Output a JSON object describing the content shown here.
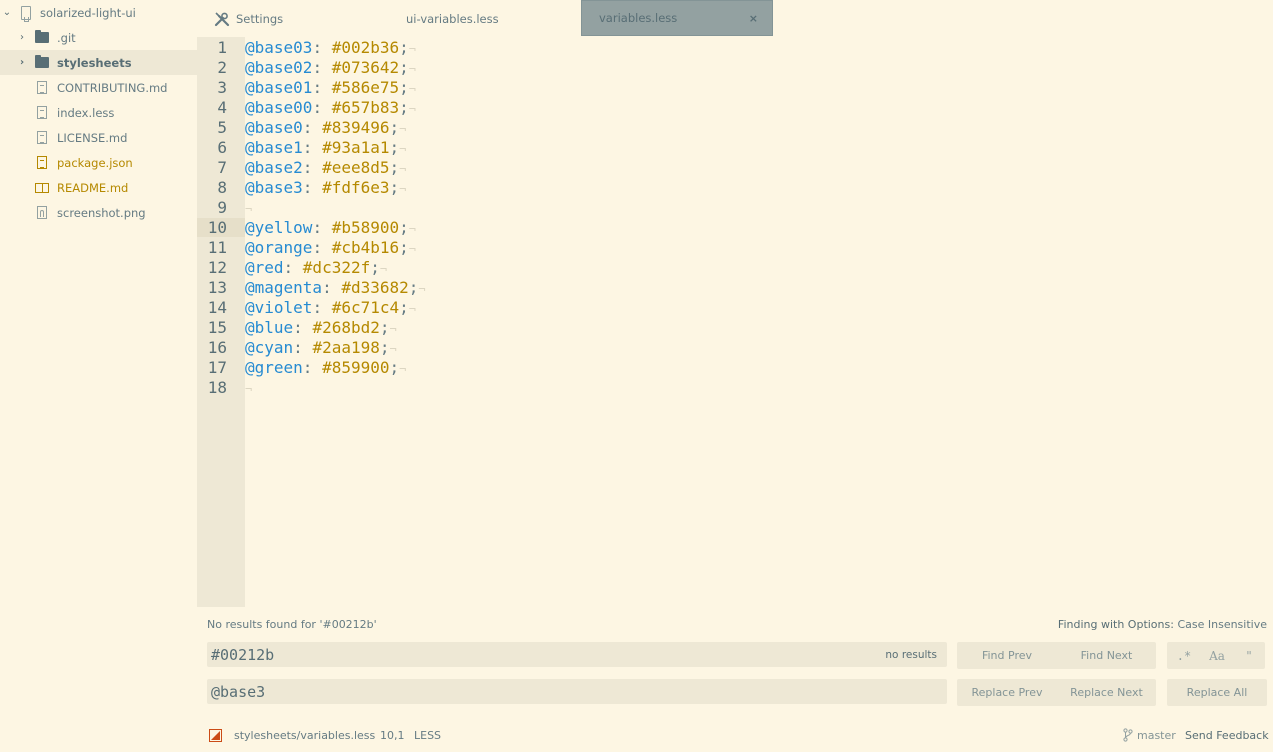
{
  "sidebar": {
    "root": {
      "label": "solarized-light-ui",
      "icon": "repo-icon",
      "expanded": true
    },
    "items": [
      {
        "label": ".git",
        "type": "folder",
        "icon": "folder-icon",
        "expanded": false
      },
      {
        "label": "stylesheets",
        "type": "folder",
        "icon": "folder-icon",
        "expanded": false,
        "selected": true
      },
      {
        "label": "CONTRIBUTING.md",
        "type": "file",
        "icon": "file-text-icon"
      },
      {
        "label": "index.less",
        "type": "file",
        "icon": "file-text-icon"
      },
      {
        "label": "LICENSE.md",
        "type": "file",
        "icon": "file-text-icon"
      },
      {
        "label": "package.json",
        "type": "file",
        "icon": "file-text-icon",
        "status": "modified"
      },
      {
        "label": "README.md",
        "type": "file",
        "icon": "book-icon",
        "status": "modified"
      },
      {
        "label": "screenshot.png",
        "type": "file",
        "icon": "file-media-icon"
      }
    ]
  },
  "tabs": [
    {
      "label": "Settings",
      "icon": "tools-icon",
      "active": false
    },
    {
      "label": "ui-variables.less",
      "active": false
    },
    {
      "label": "variables.less",
      "active": true,
      "close": "×"
    }
  ],
  "editor": {
    "cursor_line": 10,
    "eol_marker": "¬",
    "lines": [
      {
        "n": "1",
        "var": "@base03",
        "val": "#002b36"
      },
      {
        "n": "2",
        "var": "@base02",
        "val": "#073642"
      },
      {
        "n": "3",
        "var": "@base01",
        "val": "#586e75"
      },
      {
        "n": "4",
        "var": "@base00",
        "val": "#657b83"
      },
      {
        "n": "5",
        "var": "@base0",
        "val": "#839496"
      },
      {
        "n": "6",
        "var": "@base1",
        "val": "#93a1a1"
      },
      {
        "n": "7",
        "var": "@base2",
        "val": "#eee8d5"
      },
      {
        "n": "8",
        "var": "@base3",
        "val": "#fdf6e3"
      },
      {
        "n": "9",
        "var": "",
        "val": ""
      },
      {
        "n": "10",
        "var": "@yellow",
        "val": "#b58900"
      },
      {
        "n": "11",
        "var": "@orange",
        "val": "#cb4b16"
      },
      {
        "n": "12",
        "var": "@red",
        "val": "#dc322f"
      },
      {
        "n": "13",
        "var": "@magenta",
        "val": "#d33682"
      },
      {
        "n": "14",
        "var": "@violet",
        "val": "#6c71c4"
      },
      {
        "n": "15",
        "var": "@blue",
        "val": "#268bd2"
      },
      {
        "n": "16",
        "var": "@cyan",
        "val": "#2aa198"
      },
      {
        "n": "17",
        "var": "@green",
        "val": "#859900"
      },
      {
        "n": "18",
        "var": "",
        "val": ""
      }
    ]
  },
  "find": {
    "message": "No results found for '#00212b'",
    "options_label": "Finding with Options:",
    "options_value": "Case Insensitive",
    "find_value": "#00212b",
    "find_hint": "no results",
    "replace_value": "@base3",
    "find_prev": "Find Prev",
    "find_next": "Find Next",
    "regex_toggle": ".*",
    "case_toggle": "Aa",
    "word_toggle": "\"",
    "replace_prev": "Replace Prev",
    "replace_next": "Replace Next",
    "replace_all": "Replace All"
  },
  "status": {
    "file_path": "stylesheets/variables.less",
    "cursor_position": "10,1",
    "grammar": "LESS",
    "branch": "master",
    "feedback": "Send Feedback"
  },
  "colors": {
    "background": "#fdf6e3",
    "gutter": "#eee8d5",
    "variable": "#268bd2",
    "value": "#b58900",
    "active_tab": "#93a1a1",
    "modified": "#b58900",
    "status_marker": "#cb4b16"
  }
}
